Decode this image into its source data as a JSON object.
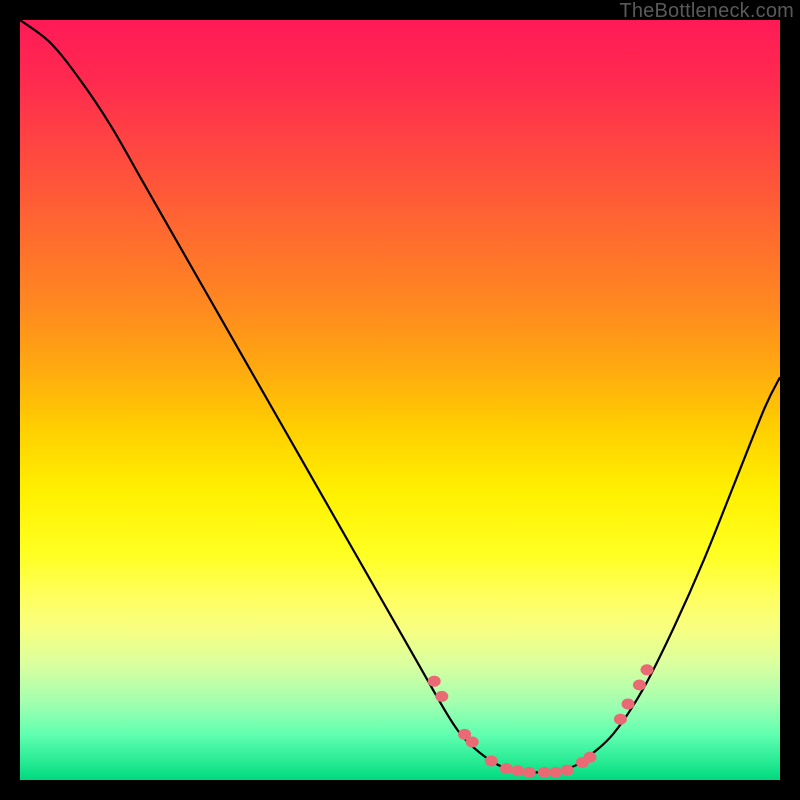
{
  "watermark": "TheBottleneck.com",
  "chart_data": {
    "type": "line",
    "title": "",
    "xlabel": "",
    "ylabel": "",
    "xlim": [
      0,
      100
    ],
    "ylim": [
      0,
      100
    ],
    "grid": false,
    "legend": false,
    "series": [
      {
        "name": "curve",
        "x": [
          0,
          4,
          8,
          12,
          16,
          20,
          24,
          28,
          32,
          36,
          40,
          44,
          48,
          52,
          56,
          58,
          60,
          62,
          64,
          66,
          68,
          70,
          72,
          74,
          78,
          82,
          86,
          90,
          94,
          98,
          100
        ],
        "y": [
          100,
          97,
          92,
          86,
          79,
          72,
          65,
          58,
          51,
          44,
          37,
          30,
          23,
          16,
          9,
          6,
          4,
          2.5,
          1.5,
          1,
          1,
          1,
          1.5,
          2.5,
          6,
          12,
          20,
          29,
          39,
          49,
          53
        ]
      }
    ],
    "highlight_points": {
      "name": "dots",
      "x": [
        54.5,
        55.5,
        58.5,
        59.5,
        62,
        64,
        65.5,
        67,
        69,
        70.5,
        72,
        74,
        75,
        79,
        80,
        81.5,
        82.5
      ],
      "y": [
        13,
        11,
        6,
        5,
        2.5,
        1.5,
        1.2,
        1,
        1,
        1,
        1.3,
        2.3,
        3,
        8,
        10,
        12.5,
        14.5
      ]
    }
  }
}
